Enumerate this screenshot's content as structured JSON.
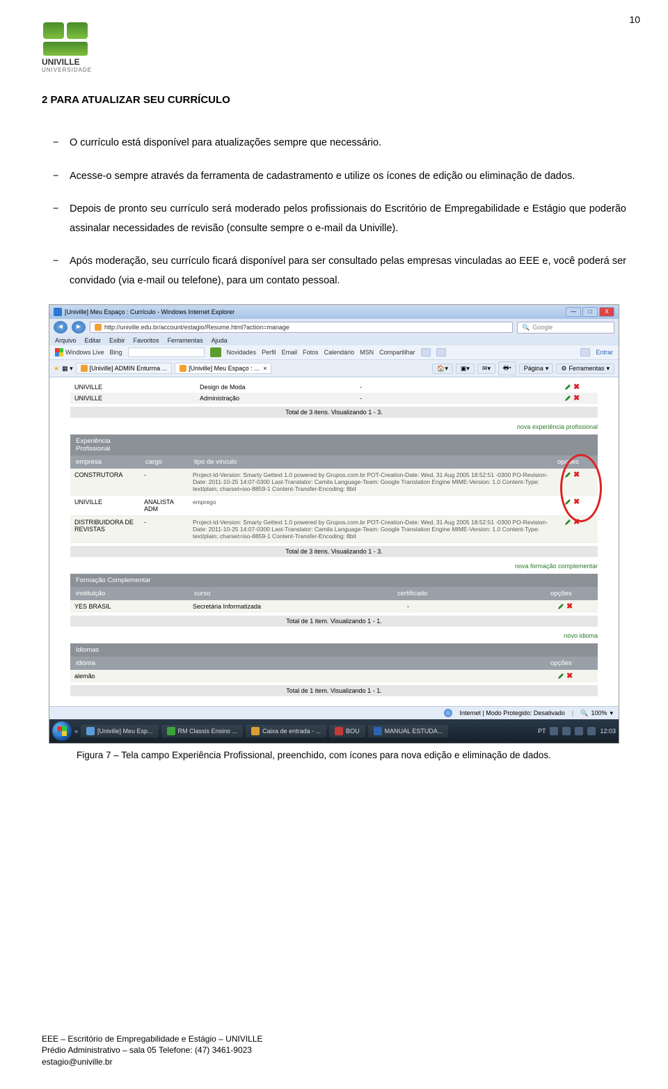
{
  "page_number": "10",
  "logo": {
    "name": "UNIVILLE",
    "sub": "UNIVERSIDADE"
  },
  "heading": "2  PARA ATUALIZAR SEU CURRÍCULO",
  "bullets": [
    "O currículo está disponível para atualizações sempre que necessário.",
    "Acesse-o sempre através da ferramenta de cadastramento e utilize os ícones de edição ou eliminação de dados.",
    "Depois de pronto seu currículo será moderado pelos profissionais do Escritório de Empregabilidade e Estágio que poderão assinalar necessidades de revisão (consulte sempre o e-mail da Univille).",
    "Após moderação, seu currículo ficará disponível para ser consultado pelas empresas vinculadas ao EEE e, você poderá ser convidado (via e-mail ou telefone), para um contato pessoal."
  ],
  "screenshot": {
    "titlebar": "[Univille] Meu Espaço : Currículo - Windows Internet Explorer",
    "url": "http://univille.edu.br/account/estagio/Resume.html?action=manage",
    "search_placeholder": "Google",
    "menu": [
      "Arquivo",
      "Editar",
      "Exibir",
      "Favoritos",
      "Ferramentas",
      "Ajuda"
    ],
    "livebar": {
      "brand": "Windows Live",
      "bing": "Bing",
      "items": [
        "Novidades",
        "Perfil",
        "Email",
        "Fotos",
        "Calendário",
        "MSN",
        "Compartilhar"
      ],
      "entrar": "Entrar"
    },
    "tabs": {
      "left": "[Univille] ADMIN Enturma ...",
      "active": "[Univille] Meu Espaço : ...",
      "page": "Página",
      "tools": "Ferramentas"
    },
    "top_rows": [
      {
        "a": "UNIVILLE",
        "b": "Design de Moda",
        "c": "-"
      },
      {
        "a": "UNIVILLE",
        "b": "Administração",
        "c": "-"
      }
    ],
    "top_total": "Total de 3 itens. Visualizando 1 - 3.",
    "links": {
      "nova_exp": "nova experiência profissional",
      "nova_form": "nova formação complementar",
      "novo_idioma": "novo idioma"
    },
    "exp": {
      "title": "Experiência Profissional",
      "cols": [
        "empresa",
        "cargo",
        "tipo de vínculo",
        "opções"
      ],
      "rows": [
        {
          "empresa": "CONSTRUTORA",
          "cargo": "-",
          "vinc": "Project-Id-Version: Smarty Gettext 1.0 powered by Grupos.com.br POT-Creation-Date: Wed, 31 Aug 2005 18:52:51 -0300 PO-Revision-Date: 2011-10-25 14:07-0300 Last-Translator: Camila Language-Team: Google Translation Engine MIME-Version: 1.0 Content-Type: text/plain; charset=iso-8859-1 Content-Transfer-Encoding: 8bit"
        },
        {
          "empresa": "UNIVILLE",
          "cargo": "ANALISTA ADM",
          "vinc": "emprego"
        },
        {
          "empresa": "DISTRIBUIDORA DE REVISTAS",
          "cargo": "-",
          "vinc": "Project-Id-Version: Smarty Gettext 1.0 powered by Grupos.com.br POT-Creation-Date: Wed, 31 Aug 2005 18:52:51 -0300 PO-Revision-Date: 2011-10-25 14:07-0300 Last-Translator: Camila Language-Team: Google Translation Engine MIME-Version: 1.0 Content-Type: text/plain; charset=iso-8859-1 Content-Transfer-Encoding: 8bit"
        }
      ],
      "total": "Total de 3 itens. Visualizando 1 - 3."
    },
    "formacao": {
      "title": "Formação Complementar",
      "cols": [
        "instituição",
        "curso",
        "certificado",
        "opções"
      ],
      "rows": [
        {
          "inst": "YES BRASIL",
          "curso": "Secretária Informatizada",
          "cert": "-"
        }
      ],
      "total": "Total de 1 item. Visualizando 1 - 1."
    },
    "idiomas": {
      "title": "Idiomas",
      "cols": [
        "idioma",
        "opções"
      ],
      "rows": [
        {
          "idioma": "alemão"
        }
      ],
      "total": "Total de 1 item. Visualizando 1 - 1."
    },
    "status": {
      "text": "Internet | Modo Protegido: Desativado",
      "zoom": "100%"
    },
    "taskbar": {
      "btns": [
        "[Univille] Meu Esp...",
        "RM Classis Ensino ...",
        "Caixa de entrada - ...",
        "BOU",
        "MANUAL ESTUDA..."
      ],
      "lang": "PT",
      "time": "12:03"
    }
  },
  "caption": "Figura 7 – Tela campo Experiência Profissional, preenchido, com ícones para nova edição e eliminação de dados.",
  "footer": {
    "l1": "EEE – Escritório de Empregabilidade e Estágio – UNIVILLE",
    "l2": "Prédio Administrativo – sala 05   Telefone: (47) 3461-9023",
    "l3": "estagio@univille.br"
  }
}
